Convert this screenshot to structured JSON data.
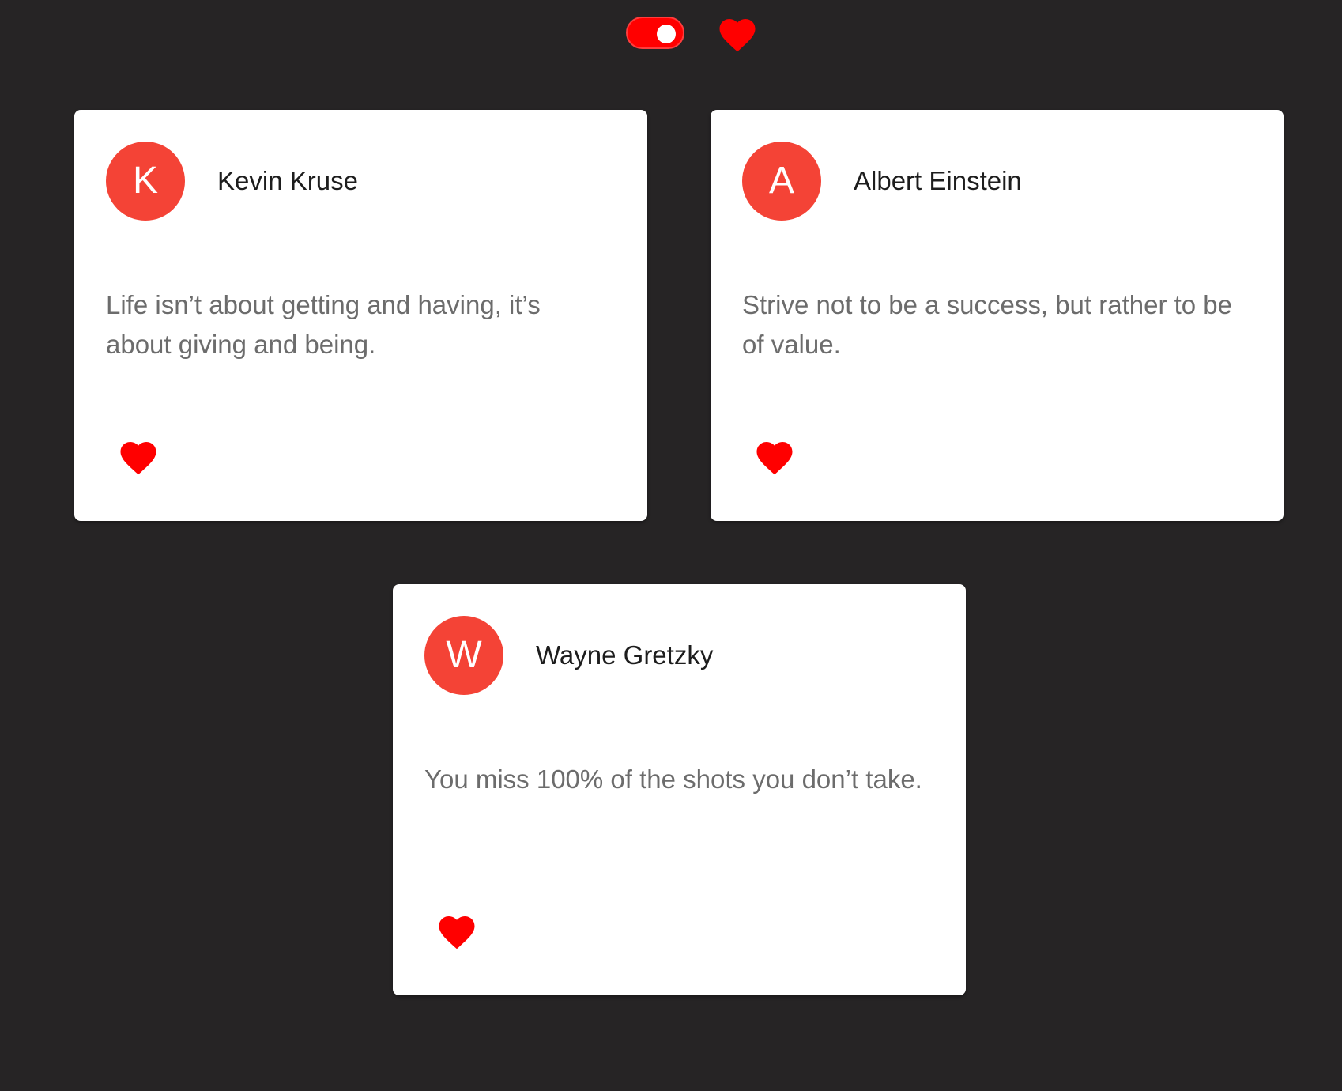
{
  "header": {
    "theme_toggle": {
      "state": "on",
      "color": "#ff0000"
    },
    "favorites_icon": "heart-icon",
    "accent_color": "#ff0000"
  },
  "quotes": [
    {
      "initial": "K",
      "author": "Kevin Kruse",
      "text": "Life isn’t about getting and having, it’s about giving and being.",
      "liked": true
    },
    {
      "initial": "A",
      "author": "Albert Einstein",
      "text": "Strive not to be a success, but rather to be of value.",
      "liked": true
    },
    {
      "initial": "W",
      "author": "Wayne Gretzky",
      "text": "You miss 100% of the shots you don’t take.",
      "liked": true
    }
  ],
  "colors": {
    "background": "#262425",
    "card": "#ffffff",
    "avatar": "#f44336",
    "heart": "#ff0000",
    "quote_text": "#6c6c6c",
    "author_text": "#1d1d1d"
  }
}
